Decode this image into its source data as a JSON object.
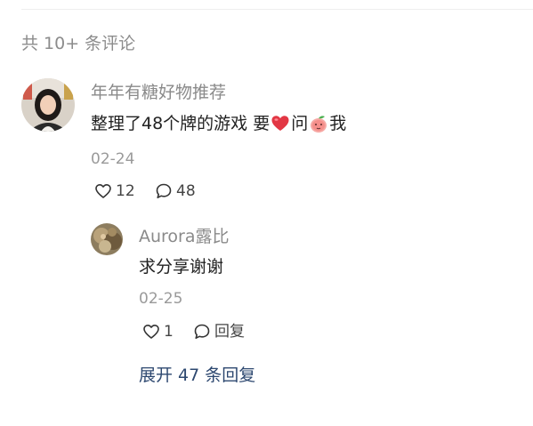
{
  "comments_header": {
    "count_text": "共 10+ 条评论"
  },
  "main_comment": {
    "username": "年年有糖好物推荐",
    "content_part1": "整理了48个牌的游戏 要",
    "content_part2": "问",
    "content_part3": "我",
    "emoji_1": "red-heart-emoji",
    "emoji_2": "peach-emoji",
    "date": "02-24",
    "likes": "12",
    "replies": "48"
  },
  "reply": {
    "username": "Aurora露比",
    "content": "求分享谢谢",
    "date": "02-25",
    "likes": "1",
    "reply_label": "回复"
  },
  "expand": {
    "label": "展开 47 条回复"
  },
  "colors": {
    "link": "#2d4870",
    "muted": "#8a8a8a",
    "text": "#222222"
  }
}
